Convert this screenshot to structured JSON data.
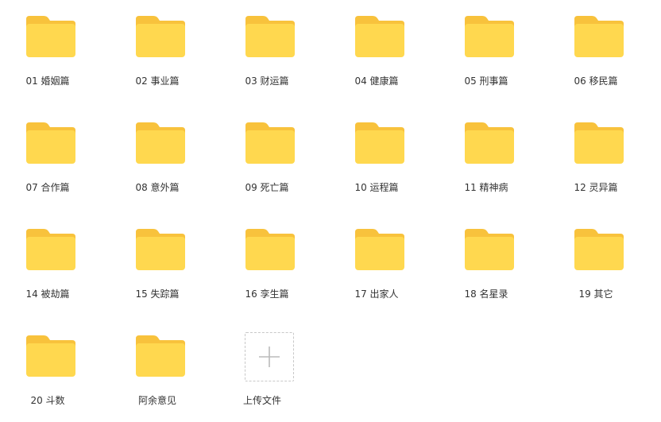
{
  "colors": {
    "folder_back": "#F8C23C",
    "folder_front": "#FFD84F",
    "text": "#333333",
    "upload_border": "#C8C8C8",
    "plus": "#BBBBBB"
  },
  "folders": [
    {
      "label": "01 婚姻篇",
      "icon": "folder-icon"
    },
    {
      "label": "02 事业篇",
      "icon": "folder-icon"
    },
    {
      "label": "03 财运篇",
      "icon": "folder-icon"
    },
    {
      "label": "04 健康篇",
      "icon": "folder-icon"
    },
    {
      "label": "05 刑事篇",
      "icon": "folder-icon"
    },
    {
      "label": "06 移民篇",
      "icon": "folder-icon"
    },
    {
      "label": "07 合作篇",
      "icon": "folder-icon"
    },
    {
      "label": "08 意外篇",
      "icon": "folder-icon"
    },
    {
      "label": "09 死亡篇",
      "icon": "folder-icon"
    },
    {
      "label": "10 运程篇",
      "icon": "folder-icon"
    },
    {
      "label": "11 精神病",
      "icon": "folder-icon"
    },
    {
      "label": "12 灵异篇",
      "icon": "folder-icon"
    },
    {
      "label": "14 被劫篇",
      "icon": "folder-icon"
    },
    {
      "label": "15 失踪篇",
      "icon": "folder-icon"
    },
    {
      "label": "16 孪生篇",
      "icon": "folder-icon"
    },
    {
      "label": "17 出家人",
      "icon": "folder-icon"
    },
    {
      "label": "18 名星录",
      "icon": "folder-icon"
    },
    {
      "label": "19 其它",
      "icon": "folder-icon"
    },
    {
      "label": "20 斗数",
      "icon": "folder-icon"
    },
    {
      "label": "阿余意见",
      "icon": "folder-icon"
    }
  ],
  "upload": {
    "label": "上传文件",
    "icon": "plus-icon"
  }
}
